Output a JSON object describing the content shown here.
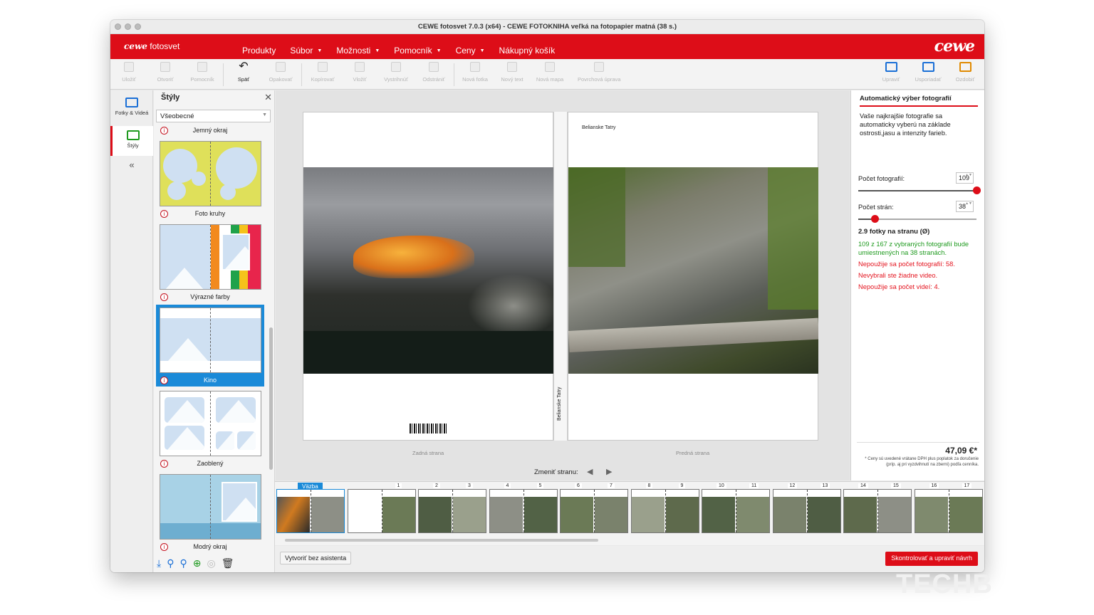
{
  "window": {
    "title": "CEWE fotosvet 7.0.3 (x64) - CEWE FOTOKNIHA veľká na fotopapier matná (38 s.)"
  },
  "app": {
    "logo_brand": "cewe",
    "logo_product": "fotosvet",
    "brand": "cewe"
  },
  "menu": [
    {
      "label": "Produkty"
    },
    {
      "label": "Súbor",
      "caret": "▼"
    },
    {
      "label": "Možnosti",
      "caret": "▼"
    },
    {
      "label": "Pomocník",
      "caret": "▼"
    },
    {
      "label": "Ceny",
      "caret": "▼"
    },
    {
      "label": "Nákupný košík"
    }
  ],
  "toolbar": {
    "items": [
      {
        "label": "Uložiť"
      },
      {
        "label": "Otvoriť"
      },
      {
        "label": "Pomocník"
      },
      {
        "label": "Späť",
        "icon": "↶"
      },
      {
        "label": "Opakovať"
      },
      {
        "label": "Kopírovať"
      },
      {
        "label": "Vložiť"
      },
      {
        "label": "Vystrihnúť"
      },
      {
        "label": "Odstrániť"
      },
      {
        "label": "Nová fotka"
      },
      {
        "label": "Nový text"
      },
      {
        "label": "Nová mapa"
      },
      {
        "label": "Povrchová úprava"
      }
    ],
    "right": [
      {
        "label": "Upraviť"
      },
      {
        "label": "Usporiadať"
      },
      {
        "label": "Ozdobiť"
      }
    ]
  },
  "left_tabs": [
    {
      "label": "Fotky & Videá"
    },
    {
      "label": "Štýly"
    }
  ],
  "collapse_glyph": "«",
  "styles_panel": {
    "title": "Štýly",
    "close_glyph": "✕",
    "select_value": "Všeobecné",
    "select_arrow": "▼",
    "items": [
      {
        "label": "Jemný okraj"
      },
      {
        "label": "Foto kruhy"
      },
      {
        "label": "Výrazné farby"
      },
      {
        "label": "Kino"
      },
      {
        "label": "Zaoblený"
      },
      {
        "label": "Modrý okraj"
      }
    ],
    "info_glyph": "i",
    "bottom_icons": [
      "⤓",
      "⚲",
      "⚲",
      "⊕",
      "◎",
      "🗑"
    ]
  },
  "canvas": {
    "front_title": "Belianske Tatry",
    "spine_text": "Belianske Tatry",
    "back_label": "Zadná strana",
    "front_label": "Predná strana",
    "change_page": "Zmeniť stranu:",
    "prev": "◀",
    "next": "▶"
  },
  "auto_panel": {
    "title": "Automatický výber fotografií",
    "description": "Vaše najkrajšie fotografie sa automaticky vyberú na základe ostrosti,jasu a intenzity farieb.",
    "photos_label": "Počet fotografií:",
    "photos_value": "109",
    "photos_slider": 1.0,
    "pages_label": "Počet strán:",
    "pages_value": "38",
    "pages_slider": 0.14,
    "spin_arrows": "▲▼",
    "avg": "2.9 fotky na stranu (Ø)",
    "msg_ok": "109 z 167 z vybraných fotografií bude umiestnených na 38 stranách.",
    "msg_unused_photos": "Nepoužije sa počet fotografií: 58.",
    "msg_no_video": "Nevybrali ste žiadne video.",
    "msg_unused_video": "Nepoužije sa počet videí: 4.",
    "price": "47,09 €*",
    "price_note": "* Ceny sú uvedené vrátane DPH plus poplatok za doručenie (príp. aj pri vyzdvihnutí na zberni) podľa cenníka."
  },
  "strip": {
    "cover_label": "Väzba",
    "numbers": [
      "1",
      "2",
      "3",
      "4",
      "5",
      "6",
      "7",
      "8",
      "9",
      "10",
      "11",
      "12",
      "13",
      "14",
      "15",
      "16",
      "17"
    ]
  },
  "bottom": {
    "create_button": "Vytvoriť bez asistenta",
    "check_button": "Skontrolovať a upraviť návrh"
  },
  "watermark": "TECHB",
  "colors": {
    "brand_red": "#dd0d18",
    "accent_blue": "#1a8ad8",
    "ok_green": "#1f9a1f",
    "warn_red": "#e4141f"
  }
}
